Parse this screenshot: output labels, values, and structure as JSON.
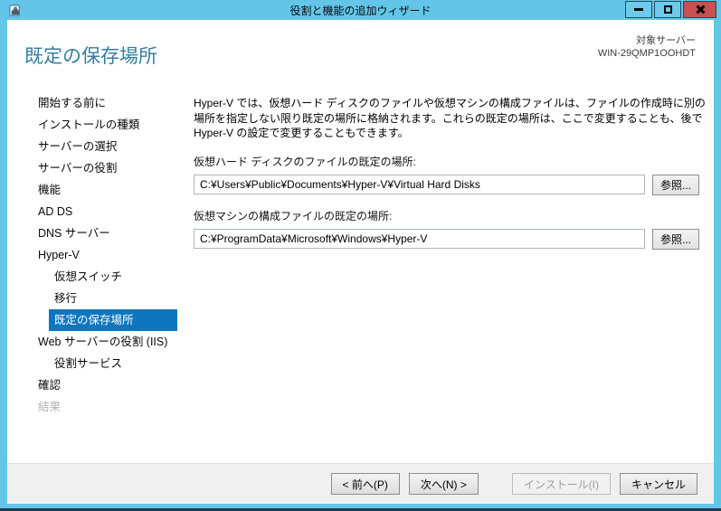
{
  "window": {
    "title": "役割と機能の追加ウィザード"
  },
  "header": {
    "title": "既定の保存場所",
    "target_server_label": "対象サーバー",
    "target_server_name": "WIN-29QMP1OOHDT"
  },
  "sidebar": {
    "items": [
      {
        "label": "開始する前に",
        "indent": 0,
        "state": "normal"
      },
      {
        "label": "インストールの種類",
        "indent": 0,
        "state": "normal"
      },
      {
        "label": "サーバーの選択",
        "indent": 0,
        "state": "normal"
      },
      {
        "label": "サーバーの役割",
        "indent": 0,
        "state": "normal"
      },
      {
        "label": "機能",
        "indent": 0,
        "state": "normal"
      },
      {
        "label": "AD DS",
        "indent": 0,
        "state": "normal"
      },
      {
        "label": "DNS サーバー",
        "indent": 0,
        "state": "normal"
      },
      {
        "label": "Hyper-V",
        "indent": 0,
        "state": "normal"
      },
      {
        "label": "仮想スイッチ",
        "indent": 1,
        "state": "normal"
      },
      {
        "label": "移行",
        "indent": 1,
        "state": "normal"
      },
      {
        "label": "既定の保存場所",
        "indent": 1,
        "state": "selected"
      },
      {
        "label": "Web サーバーの役割 (IIS)",
        "indent": 0,
        "state": "normal"
      },
      {
        "label": "役割サービス",
        "indent": 1,
        "state": "normal"
      },
      {
        "label": "確認",
        "indent": 0,
        "state": "normal"
      },
      {
        "label": "結果",
        "indent": 0,
        "state": "disabled"
      }
    ]
  },
  "content": {
    "description": "Hyper-V では、仮想ハード ディスクのファイルや仮想マシンの構成ファイルは、ファイルの作成時に別の場所を指定しない限り既定の場所に格納されます。これらの既定の場所は、ここで変更することも、後で Hyper-V の設定で変更することもできます。",
    "fields": [
      {
        "label": "仮想ハード ディスクのファイルの既定の場所:",
        "value": "C:¥Users¥Public¥Documents¥Hyper-V¥Virtual Hard Disks",
        "browse_label": "参照..."
      },
      {
        "label": "仮想マシンの構成ファイルの既定の場所:",
        "value": "C:¥ProgramData¥Microsoft¥Windows¥Hyper-V",
        "browse_label": "参照..."
      }
    ]
  },
  "footer": {
    "prev_label": "< 前へ(P)",
    "next_label": "次へ(N) >",
    "install_label": "インストール(I)",
    "cancel_label": "キャンセル"
  },
  "colors": {
    "titlebar_blue": "#63c6e9",
    "heading_teal": "#337e9e",
    "selection_blue": "#0e76bd",
    "close_red": "#c75050",
    "footer_gray": "#f0f0f0"
  },
  "icons": {
    "app_icon": "server-manager-toolbox",
    "minimize": "minimize-bar",
    "maximize": "maximize-square",
    "close": "close-x"
  }
}
